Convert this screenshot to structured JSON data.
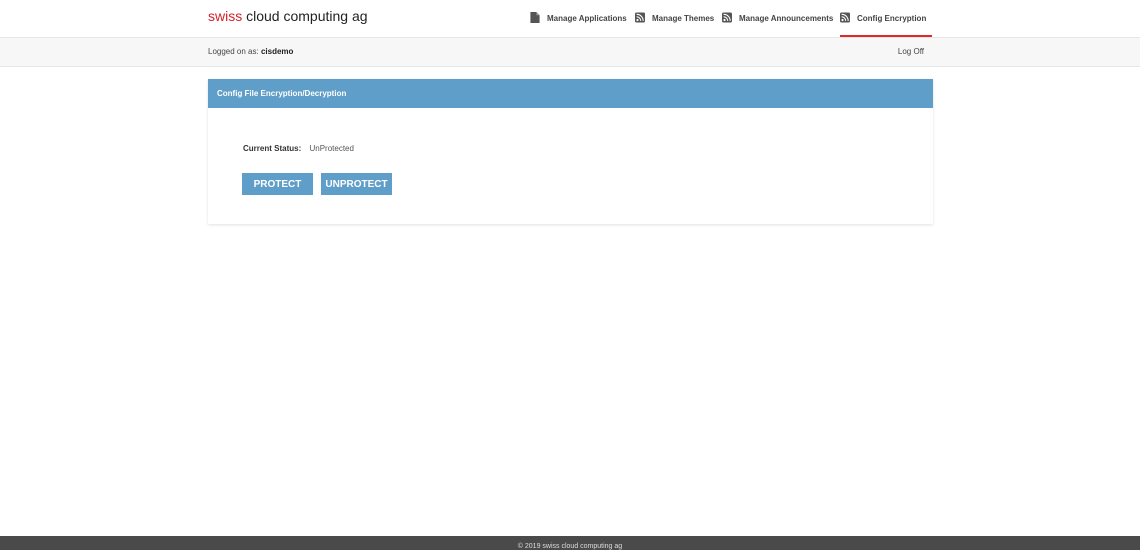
{
  "brand": {
    "accent": "swiss",
    "rest": " cloud computing ag"
  },
  "nav": {
    "items": [
      {
        "label": "Manage Applications",
        "icon": "document-icon"
      },
      {
        "label": "Manage Themes",
        "icon": "rss-icon"
      },
      {
        "label": "Manage Announcements",
        "icon": "rss-icon"
      },
      {
        "label": "Config Encryption",
        "icon": "rss-icon",
        "active": true
      }
    ]
  },
  "session": {
    "prefix": "Logged on as:",
    "user": "cisdemo",
    "logoff": "Log Off"
  },
  "panel": {
    "title": "Config File Encryption/Decryption",
    "status_label": "Current Status:",
    "status_value": "UnProtected",
    "protect_label": "PROTECT",
    "unprotect_label": "UNPROTECT"
  },
  "footer": {
    "text": "© 2019 swiss cloud computing ag"
  },
  "colors": {
    "accent_red": "#d6202a",
    "active_underline": "#e02a2a",
    "primary_blue": "#5f9ec8",
    "footer_bg": "#4a4a4a"
  }
}
